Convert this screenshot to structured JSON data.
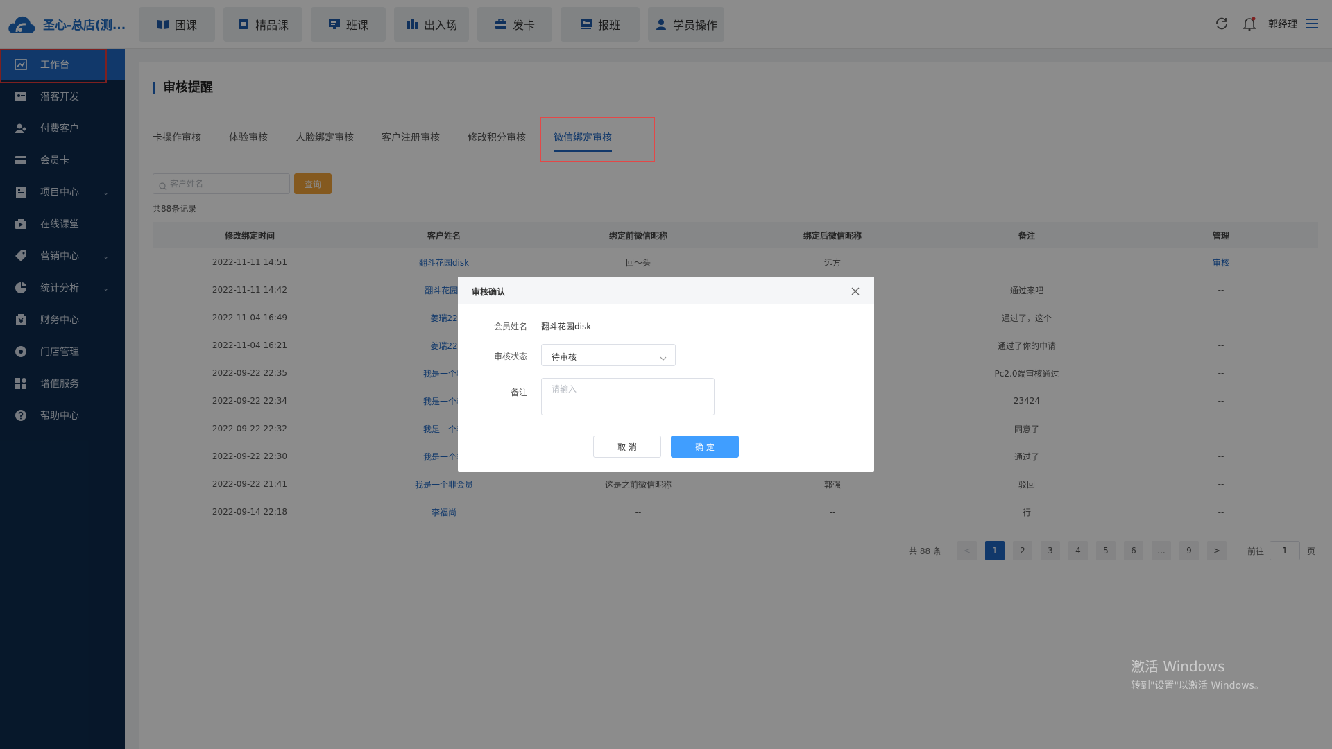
{
  "app": {
    "brand": "圣心-总店(测..."
  },
  "topnav": [
    {
      "label": "团课",
      "icon": "book-icon"
    },
    {
      "label": "精品课",
      "icon": "star-icon"
    },
    {
      "label": "班课",
      "icon": "board-icon"
    },
    {
      "label": "出入场",
      "icon": "door-icon"
    },
    {
      "label": "发卡",
      "icon": "card-icon"
    },
    {
      "label": "报班",
      "icon": "signup-icon"
    },
    {
      "label": "学员操作",
      "icon": "student-icon"
    }
  ],
  "topright": {
    "user": "郭经理"
  },
  "sidebar": [
    {
      "label": "工作台",
      "icon": "dashboard-icon",
      "active": true
    },
    {
      "label": "潜客开发",
      "icon": "prospect-icon"
    },
    {
      "label": "付费客户",
      "icon": "customer-icon"
    },
    {
      "label": "会员卡",
      "icon": "membership-card-icon"
    },
    {
      "label": "项目中心",
      "icon": "project-icon",
      "chevron": "⌄"
    },
    {
      "label": "在线课堂",
      "icon": "video-icon"
    },
    {
      "label": "营销中心",
      "icon": "tag-icon",
      "chevron": "⌄"
    },
    {
      "label": "统计分析",
      "icon": "pie-chart-icon",
      "chevron": "⌄"
    },
    {
      "label": "财务中心",
      "icon": "finance-icon"
    },
    {
      "label": "门店管理",
      "icon": "store-icon"
    },
    {
      "label": "增值服务",
      "icon": "apps-icon"
    },
    {
      "label": "帮助中心",
      "icon": "help-icon"
    }
  ],
  "main": {
    "title": "审核提醒",
    "tabs": [
      {
        "label": "卡操作审核"
      },
      {
        "label": "体验审核"
      },
      {
        "label": "人脸绑定审核"
      },
      {
        "label": "客户注册审核"
      },
      {
        "label": "修改积分审核"
      },
      {
        "label": "微信绑定审核",
        "active": true
      }
    ],
    "search": {
      "placeholder": "客户姓名",
      "button": "查询"
    },
    "total_records": "共88条记录",
    "table": {
      "headers": [
        "修改绑定时间",
        "客户姓名",
        "绑定前微信昵称",
        "绑定后微信昵称",
        "备注",
        "管理"
      ],
      "rows": [
        [
          "2022-11-11 14:51",
          "翻斗花园disk",
          "回～头",
          "远方",
          "",
          "审核"
        ],
        [
          "2022-11-11 14:42",
          "翻斗花园d",
          "",
          "",
          "通过来吧",
          "--"
        ],
        [
          "2022-11-04 16:49",
          "姜瑞22",
          "",
          "",
          "通过了，这个",
          "--"
        ],
        [
          "2022-11-04 16:21",
          "姜瑞22",
          "",
          "",
          "通过了你的申请",
          "--"
        ],
        [
          "2022-09-22 22:35",
          "我是一个非",
          "",
          "",
          "Pc2.0端审核通过",
          "--"
        ],
        [
          "2022-09-22 22:34",
          "我是一个非",
          "",
          "",
          "23424",
          "--"
        ],
        [
          "2022-09-22 22:32",
          "我是一个非",
          "",
          "",
          "同意了",
          "--"
        ],
        [
          "2022-09-22 22:30",
          "我是一个非",
          "",
          "",
          "通过了",
          "--"
        ],
        [
          "2022-09-22 21:41",
          "我是一个非会员",
          "这是之前微信昵称",
          "郭强",
          "驳回",
          "--"
        ],
        [
          "2022-09-14 22:18",
          "李福尚",
          "--",
          "--",
          "行",
          "--"
        ]
      ]
    },
    "pager": {
      "total": "共 88 条",
      "prev": "<",
      "pages": [
        "1",
        "2",
        "3",
        "4",
        "5",
        "6",
        "...",
        "9"
      ],
      "next": ">",
      "goto_label": "前往",
      "goto_value": "1",
      "page_suffix": "页"
    }
  },
  "dialog": {
    "title": "审核确认",
    "member_label": "会员姓名",
    "member_value": "翻斗花园disk",
    "status_label": "审核状态",
    "status_value": "待审核",
    "remark_label": "备注",
    "remark_placeholder": "请输入",
    "cancel": "取 消",
    "ok": "确 定"
  },
  "watermark": {
    "line1": "激活 Windows",
    "line2": "转到\"设置\"以激活 Windows。"
  },
  "colors": {
    "primary": "#1f67c2",
    "sidebar": "#0d2b4e",
    "accent": "#f0a23a",
    "ok_button": "#409eff",
    "highlight": "#e33b3b"
  }
}
